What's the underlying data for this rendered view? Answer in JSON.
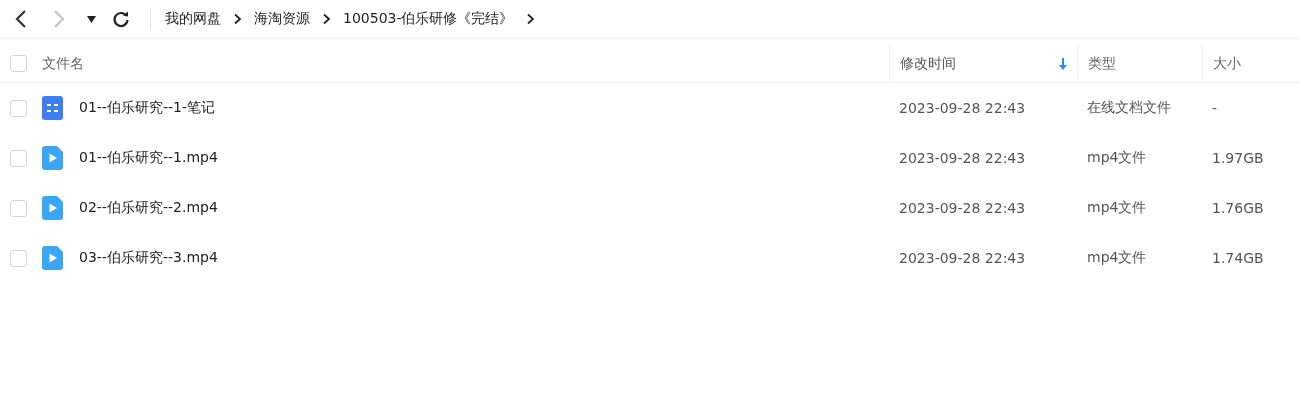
{
  "toolbar": {
    "back_disabled": false,
    "forward_disabled": true
  },
  "breadcrumbs": [
    "我的网盘",
    "海淘资源",
    "100503-伯乐研修《完结》"
  ],
  "table": {
    "select_all_checked": false,
    "columns": [
      {
        "label": "文件名",
        "sorted": false
      },
      {
        "label": "修改时间",
        "sorted": true
      },
      {
        "label": "类型",
        "sorted": false
      },
      {
        "label": "大小",
        "sorted": false
      }
    ],
    "rows": [
      {
        "kind": "doc",
        "checked": false,
        "name": "01--伯乐研究--1-笔记",
        "modified": "2023-09-28 22:43",
        "type": "在线文档文件",
        "size": "-"
      },
      {
        "kind": "video",
        "checked": false,
        "name": "01--伯乐研究--1.mp4",
        "modified": "2023-09-28 22:43",
        "type": "mp4文件",
        "size": "1.97GB"
      },
      {
        "kind": "video",
        "checked": false,
        "name": "02--伯乐研究--2.mp4",
        "modified": "2023-09-28 22:43",
        "type": "mp4文件",
        "size": "1.76GB"
      },
      {
        "kind": "video",
        "checked": false,
        "name": "03--伯乐研究--3.mp4",
        "modified": "2023-09-28 22:43",
        "type": "mp4文件",
        "size": "1.74GB"
      }
    ]
  }
}
